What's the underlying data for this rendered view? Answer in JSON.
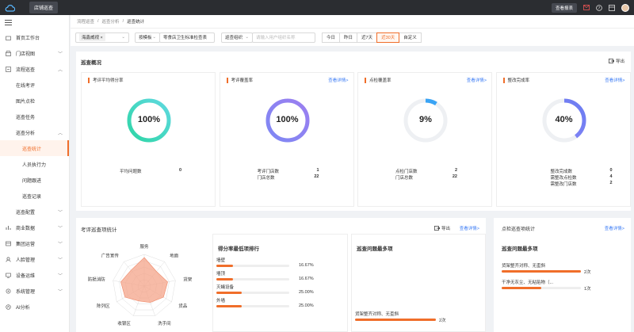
{
  "topbar": {
    "store_button": "店铺巡查",
    "download_label": "查看报表"
  },
  "sidebar": {
    "items": [
      {
        "label": "首页工作台",
        "icon": "home-icon",
        "level": 0,
        "chevron": false
      },
      {
        "label": "门店视图",
        "icon": "store-icon",
        "level": 0,
        "chevron": true
      },
      {
        "label": "流程巡查",
        "icon": "flow-icon",
        "level": 0,
        "chevron": true,
        "open": true
      },
      {
        "label": "在线考评",
        "level": 1
      },
      {
        "label": "图片点检",
        "level": 1
      },
      {
        "label": "巡查任务",
        "level": 1
      },
      {
        "label": "巡查分析",
        "level": 1,
        "chevron": true,
        "open": true
      },
      {
        "label": "巡查统计",
        "level": 2,
        "active": true
      },
      {
        "label": "人员执行力",
        "level": 2
      },
      {
        "label": "问题跟进",
        "level": 2
      },
      {
        "label": "巡查记录",
        "level": 2
      },
      {
        "label": "巡查配置",
        "level": 1,
        "chevron": true
      },
      {
        "label": "商业数据",
        "icon": "chart-icon",
        "level": 0,
        "chevron": true
      },
      {
        "label": "集团运营",
        "icon": "group-icon",
        "level": 0,
        "chevron": true
      },
      {
        "label": "人脸管理",
        "icon": "face-icon",
        "level": 0,
        "chevron": true
      },
      {
        "label": "设备运维",
        "icon": "device-icon",
        "level": 0,
        "chevron": true
      },
      {
        "label": "系统管理",
        "icon": "settings-icon",
        "level": 0,
        "chevron": true
      },
      {
        "label": "AI分析",
        "icon": "ai-icon",
        "level": 0,
        "chevron": false
      }
    ]
  },
  "breadcrumb": {
    "a": "流程巡查",
    "b": "巡查分析",
    "c": "巡查统计"
  },
  "filters": {
    "tag1": "海鑫威视",
    "sel2": "按模板",
    "sel3": "零食店卫生标准检查表",
    "sel4": "巡查组织",
    "placeholder": "请输入用户组织名称",
    "dates": [
      "今日",
      "昨日",
      "近7天",
      "近30天",
      "自定义"
    ],
    "active_date": 3
  },
  "overview": {
    "title": "巡查概况",
    "export": "导出"
  },
  "cards": [
    {
      "title": "考评平均得分率",
      "link": "",
      "value": "100%",
      "ratio": 1.0,
      "color1": "#2ed6a6",
      "color2": "#5fd9e0",
      "stats": [
        {
          "label": "平均问题数",
          "value": "0"
        }
      ]
    },
    {
      "title": "考评覆盖率",
      "link": "查看详情>",
      "value": "100%",
      "ratio": 1.0,
      "color1": "#7e88f4",
      "color2": "#9b7ef0",
      "stats": [
        {
          "label": "考评门店数",
          "value": "1"
        },
        {
          "label": "门店总数",
          "value": "22"
        }
      ]
    },
    {
      "title": "点检覆盖率",
      "link": "查看详情>",
      "value": "9%",
      "ratio": 0.09,
      "color1": "#3aa4f5",
      "color2": "#3aa4f5",
      "stats": [
        {
          "label": "点检门店数",
          "value": "2"
        },
        {
          "label": "门店总数",
          "value": "22"
        }
      ]
    },
    {
      "title": "整改完成率",
      "link": "查看详情>",
      "value": "40%",
      "ratio": 0.4,
      "color1": "#8a86f5",
      "color2": "#6b7cf2",
      "stats": [
        {
          "label": "整改完成数",
          "value": "0"
        },
        {
          "label": "需整改点检数",
          "value": "4"
        },
        {
          "label": "需整改门店数",
          "value": "2"
        }
      ]
    }
  ],
  "inspect": {
    "title": "考评巡查项统计",
    "export": "导出",
    "link": "查看详情>"
  },
  "radar": {
    "labels": [
      "服务",
      "地面",
      "货架",
      "货品",
      "洗手间",
      "收银区",
      "陈列区",
      "防损消防",
      "广告宣传"
    ],
    "values": [
      0.9,
      0.6,
      0.75,
      0.7,
      0.55,
      0.5,
      0.7,
      0.75,
      0.65
    ]
  },
  "ranking": {
    "title": "得分率最低项排行",
    "rows": [
      {
        "label": "墙壁",
        "pct": "16.67%",
        "ratio": 0.1667
      },
      {
        "label": "墙顶",
        "pct": "16.67%",
        "ratio": 0.1667
      },
      {
        "label": "灭蝇设备",
        "pct": "25.00%",
        "ratio": 0.25
      },
      {
        "label": "外墙",
        "pct": "25.00%",
        "ratio": 0.25
      }
    ]
  },
  "problems": {
    "title": "巡查问题最多项",
    "rows": [
      {
        "label": "货架整齐对称、无歪斜",
        "count": "2次",
        "ratio": 1.0
      }
    ]
  },
  "spot": {
    "title": "点检巡查项统计",
    "link": "查看详情>",
    "sub": "巡查问题最多项",
    "rows": [
      {
        "label": "货架整齐对称、无歪斜",
        "count": "2次",
        "ratio": 1.0
      },
      {
        "label": "干净无灰尘、无粘贴物（...",
        "count": "1次",
        "ratio": 0.5
      }
    ]
  },
  "colors": {
    "accent": "#f06e2a",
    "link": "#3b7cf5"
  }
}
